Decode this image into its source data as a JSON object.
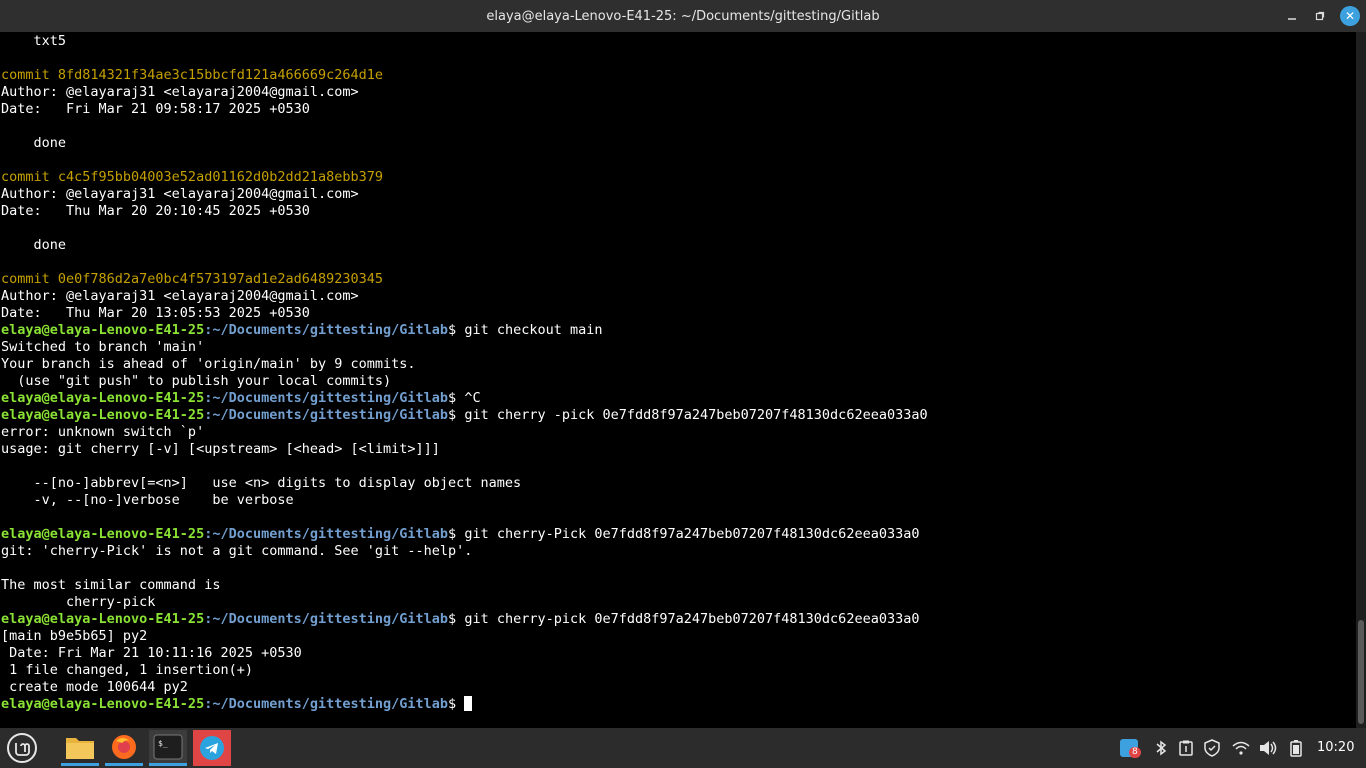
{
  "window": {
    "title": "elaya@elaya-Lenovo-E41-25: ~/Documents/gittesting/Gitlab"
  },
  "prompt": {
    "user_host": "elaya@elaya-Lenovo-E41-25",
    "path": ":~/Documents/gittesting/Gitlab"
  },
  "terminal": {
    "lines": [
      {
        "type": "text",
        "text": "    txt5"
      },
      {
        "type": "text",
        "text": ""
      },
      {
        "type": "commit",
        "text": "commit 8fd814321f34ae3c15bbcfd121a466669c264d1e"
      },
      {
        "type": "text",
        "text": "Author: @elayaraj31 <elayaraj2004@gmail.com>"
      },
      {
        "type": "text",
        "text": "Date:   Fri Mar 21 09:58:17 2025 +0530"
      },
      {
        "type": "text",
        "text": ""
      },
      {
        "type": "text",
        "text": "    done"
      },
      {
        "type": "text",
        "text": ""
      },
      {
        "type": "commit",
        "text": "commit c4c5f95bb04003e52ad01162d0b2dd21a8ebb379"
      },
      {
        "type": "text",
        "text": "Author: @elayaraj31 <elayaraj2004@gmail.com>"
      },
      {
        "type": "text",
        "text": "Date:   Thu Mar 20 20:10:45 2025 +0530"
      },
      {
        "type": "text",
        "text": ""
      },
      {
        "type": "text",
        "text": "    done"
      },
      {
        "type": "text",
        "text": ""
      },
      {
        "type": "commit",
        "text": "commit 0e0f786d2a7e0bc4f573197ad1e2ad6489230345"
      },
      {
        "type": "text",
        "text": "Author: @elayaraj31 <elayaraj2004@gmail.com>"
      },
      {
        "type": "text",
        "text": "Date:   Thu Mar 20 13:05:53 2025 +0530"
      },
      {
        "type": "prompt",
        "cmd": "git checkout main"
      },
      {
        "type": "text",
        "text": "Switched to branch 'main'"
      },
      {
        "type": "text",
        "text": "Your branch is ahead of 'origin/main' by 9 commits."
      },
      {
        "type": "text",
        "text": "  (use \"git push\" to publish your local commits)"
      },
      {
        "type": "prompt",
        "cmd": "^C"
      },
      {
        "type": "prompt",
        "cmd": "git cherry -pick 0e7fdd8f97a247beb07207f48130dc62eea033a0"
      },
      {
        "type": "text",
        "text": "error: unknown switch `p'"
      },
      {
        "type": "text",
        "text": "usage: git cherry [-v] [<upstream> [<head> [<limit>]]]"
      },
      {
        "type": "text",
        "text": ""
      },
      {
        "type": "text",
        "text": "    --[no-]abbrev[=<n>]   use <n> digits to display object names"
      },
      {
        "type": "text",
        "text": "    -v, --[no-]verbose    be verbose"
      },
      {
        "type": "text",
        "text": ""
      },
      {
        "type": "prompt",
        "cmd": "git cherry-Pick 0e7fdd8f97a247beb07207f48130dc62eea033a0"
      },
      {
        "type": "text",
        "text": "git: 'cherry-Pick' is not a git command. See 'git --help'."
      },
      {
        "type": "text",
        "text": ""
      },
      {
        "type": "text",
        "text": "The most similar command is"
      },
      {
        "type": "text",
        "text": "        cherry-pick"
      },
      {
        "type": "prompt",
        "cmd": "git cherry-pick 0e7fdd8f97a247beb07207f48130dc62eea033a0"
      },
      {
        "type": "text",
        "text": "[main b9e5b65] py2"
      },
      {
        "type": "text",
        "text": " Date: Fri Mar 21 10:11:16 2025 +0530"
      },
      {
        "type": "text",
        "text": " 1 file changed, 1 insertion(+)"
      },
      {
        "type": "text",
        "text": " create mode 100644 py2"
      },
      {
        "type": "prompt",
        "cmd": "",
        "cursor": true
      }
    ]
  },
  "taskbar": {
    "apps": [
      {
        "name": "mint-menu-button",
        "icon": "linux-mint-logo-icon"
      },
      {
        "name": "files-button",
        "icon": "folder-icon"
      },
      {
        "name": "firefox-button",
        "icon": "firefox-icon"
      },
      {
        "name": "terminal-button",
        "icon": "terminal-icon"
      },
      {
        "name": "telegram-button",
        "icon": "telegram-icon"
      }
    ],
    "tray": {
      "notification_badge": "8",
      "clock": "10:20"
    }
  },
  "colors": {
    "commit": "#c4a000",
    "prompt_user": "#8ae234",
    "prompt_path": "#729fcf",
    "accent": "#3da1e0"
  }
}
